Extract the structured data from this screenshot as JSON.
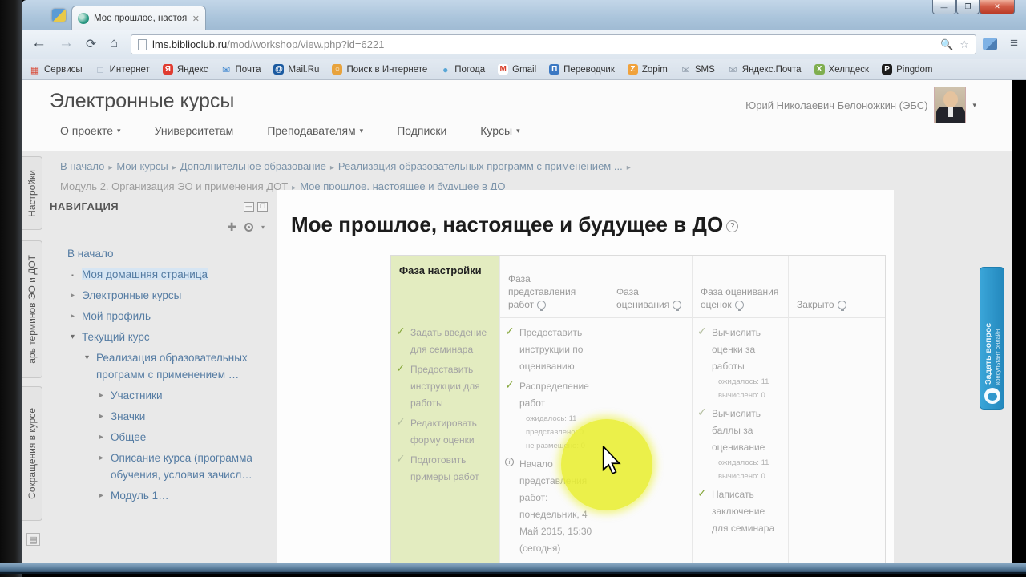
{
  "browser": {
    "tab_title": "Мое прошлое, настоящ...",
    "url": {
      "domain": "lms.biblioclub.ru",
      "path": "/mod/workshop/view.php?id=6221"
    },
    "bookmarks": [
      {
        "label": "Сервисы",
        "icon": "services",
        "glyph": "▦",
        "fg": "#d94b38",
        "bg": ""
      },
      {
        "label": "Интернет",
        "icon": "internet",
        "glyph": "□",
        "fg": "#98a7b8",
        "bg": ""
      },
      {
        "label": "Яндекс",
        "icon": "yandex",
        "glyph": "Я",
        "fg": "#ffffff",
        "bg": "#e03c31"
      },
      {
        "label": "Почта",
        "icon": "mail",
        "glyph": "✉",
        "fg": "#3f87cf",
        "bg": ""
      },
      {
        "label": "Mail.Ru",
        "icon": "mailru",
        "glyph": "@",
        "fg": "#ffffff",
        "bg": "#1b5aa0"
      },
      {
        "label": "Поиск в Интернете",
        "icon": "web-search",
        "glyph": "○",
        "fg": "#ffffff",
        "bg": "#e8a33d"
      },
      {
        "label": "Погода",
        "icon": "weather",
        "glyph": "●",
        "fg": "#58a6d6",
        "bg": ""
      },
      {
        "label": "Gmail",
        "icon": "gmail",
        "glyph": "M",
        "fg": "#d93f2b",
        "bg": "#ffffff"
      },
      {
        "label": "Переводчик",
        "icon": "translator",
        "glyph": "П",
        "fg": "#ffffff",
        "bg": "#3b78c3"
      },
      {
        "label": "Zopim",
        "icon": "zopim",
        "glyph": "Z",
        "fg": "#ffffff",
        "bg": "#f0a23c"
      },
      {
        "label": "SMS",
        "icon": "sms",
        "glyph": "✉",
        "fg": "#8b98a6",
        "bg": ""
      },
      {
        "label": "Яндекс.Почта",
        "icon": "yandex-mail",
        "glyph": "✉",
        "fg": "#8b98a6",
        "bg": ""
      },
      {
        "label": "Хелпдеск",
        "icon": "helpdesk",
        "glyph": "Х",
        "fg": "#ffffff",
        "bg": "#7fae4f"
      },
      {
        "label": "Pingdom",
        "icon": "pingdom",
        "glyph": "P",
        "fg": "#ffffff",
        "bg": "#1c1c1c"
      }
    ]
  },
  "site": {
    "title": "Электронные курсы",
    "user_name": "Юрий Николаевич Белоножкин (ЭБС)",
    "menu": [
      {
        "label": "О проекте",
        "caret": true
      },
      {
        "label": "Университетам",
        "caret": false
      },
      {
        "label": "Преподавателям",
        "caret": true
      },
      {
        "label": "Подписки",
        "caret": false
      },
      {
        "label": "Курсы",
        "caret": true
      }
    ]
  },
  "breadcrumb": {
    "line1": [
      {
        "label": "В начало",
        "muted": false
      },
      {
        "label": "Мои курсы",
        "muted": false
      },
      {
        "label": "Дополнительное образование",
        "muted": false
      },
      {
        "label": "Реализация образовательных программ с применением ...",
        "muted": false
      }
    ],
    "line2": [
      {
        "label": "Модуль 2. Организация ЭО и применения ДОТ",
        "muted": true
      },
      {
        "label": "Мое прошлое, настоящее и будущее в ДО",
        "muted": false
      }
    ]
  },
  "side_tabs": [
    "Настройки",
    "арь терминов ЭО и ДОТ",
    "Сокращения в курсе"
  ],
  "navigation": {
    "title": "НАВИГАЦИЯ",
    "items": [
      {
        "label": "В начало",
        "indent": 0,
        "icon": "none",
        "highlight": false
      },
      {
        "label": "Моя домашняя страница",
        "indent": 1,
        "icon": "bullet",
        "highlight": true
      },
      {
        "label": "Электронные курсы",
        "indent": 1,
        "icon": "collapsed",
        "highlight": false
      },
      {
        "label": "Мой профиль",
        "indent": 1,
        "icon": "collapsed",
        "highlight": false
      },
      {
        "label": "Текущий курс",
        "indent": 1,
        "icon": "expanded",
        "highlight": false
      },
      {
        "label": "Реализация образовательных программ с применением …",
        "indent": 2,
        "icon": "expanded",
        "highlight": false
      },
      {
        "label": "Участники",
        "indent": 3,
        "icon": "collapsed",
        "highlight": false
      },
      {
        "label": "Значки",
        "indent": 3,
        "icon": "collapsed",
        "highlight": false
      },
      {
        "label": "Общее",
        "indent": 3,
        "icon": "collapsed",
        "highlight": false
      },
      {
        "label": "Описание курса (программа обучения, условия зачисл…",
        "indent": 3,
        "icon": "collapsed",
        "highlight": false
      },
      {
        "label": "Модуль 1…",
        "indent": 3,
        "icon": "collapsed",
        "highlight": false
      }
    ]
  },
  "workshop": {
    "title": "Мое прошлое, настоящее и будущее в ДО",
    "phases": [
      {
        "name": "Фаза настройки",
        "active": true,
        "switch_icon": false,
        "tasks": [
          {
            "icon": "check-green",
            "label": "Задать введение для семинара",
            "sub": []
          },
          {
            "icon": "check-green",
            "label": "Предоставить инструкции для работы",
            "sub": []
          },
          {
            "icon": "check-dim",
            "label": "Редактировать форму оценки",
            "sub": []
          },
          {
            "icon": "check-dim",
            "label": "Подготовить примеры работ",
            "sub": []
          }
        ]
      },
      {
        "name": "Фаза представления работ",
        "active": false,
        "switch_icon": true,
        "tasks": [
          {
            "icon": "check-green",
            "label": "Предоставить инструкции по оцениванию",
            "sub": []
          },
          {
            "icon": "check-green",
            "label": "Распределение работ",
            "sub": [
              "ожидалось: 11",
              "представлено: 0",
              "не размещено: 0"
            ]
          },
          {
            "icon": "info",
            "label": "Начало представления работ: понедельник, 4 Май 2015, 15:30 (сегодня)",
            "sub": []
          }
        ]
      },
      {
        "name": "Фаза оценивания",
        "active": false,
        "switch_icon": true,
        "tasks": []
      },
      {
        "name": "Фаза оценивания оценок",
        "active": false,
        "switch_icon": true,
        "tasks": [
          {
            "icon": "check-dim",
            "label": "Вычислить оценки за работы",
            "sub": [
              "ожидалось: 11",
              "вычислено: 0"
            ]
          },
          {
            "icon": "check-dim",
            "label": "Вычислить баллы за оценивание",
            "sub": [
              "ожидалось: 11",
              "вычислено: 0"
            ]
          },
          {
            "icon": "check-green",
            "label": "Написать заключение для семинара",
            "sub": []
          }
        ]
      },
      {
        "name": "Закрыто",
        "active": false,
        "switch_icon": true,
        "tasks": []
      }
    ]
  },
  "ask_widget": {
    "line1": "Задать вопрос",
    "line2": "консультант онлайн",
    "color": "#2e97cd"
  },
  "colors": {
    "active_phase_bg": "#e3ecc0",
    "check_done": "#86a73c",
    "link_blue": "#557ca3",
    "highlight_circle": "#e9ef32"
  }
}
